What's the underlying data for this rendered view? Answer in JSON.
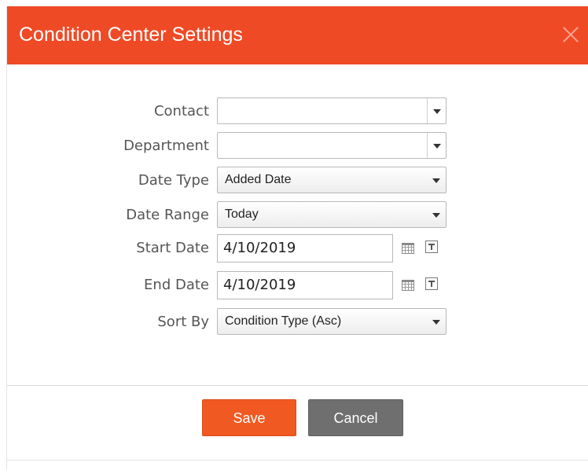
{
  "dialog": {
    "title": "Condition Center Settings",
    "close_icon": "close-icon",
    "accent_color": "#ef4a26"
  },
  "form": {
    "contact": {
      "label": "Contact",
      "value": ""
    },
    "department": {
      "label": "Department",
      "value": ""
    },
    "date_type": {
      "label": "Date Type",
      "value": "Added Date"
    },
    "date_range": {
      "label": "Date Range",
      "value": "Today"
    },
    "start_date": {
      "label": "Start Date",
      "value": "4/10/2019"
    },
    "end_date": {
      "label": "End Date",
      "value": "4/10/2019"
    },
    "sort_by": {
      "label": "Sort By",
      "value": "Condition Type (Asc)"
    }
  },
  "icons": {
    "calendar": "calendar-icon",
    "today": "today-icon",
    "dropdown": "chevron-down-icon"
  },
  "buttons": {
    "save_label": "Save",
    "save_color": "#f05a22",
    "cancel_label": "Cancel",
    "cancel_color": "#6f6f6f"
  }
}
